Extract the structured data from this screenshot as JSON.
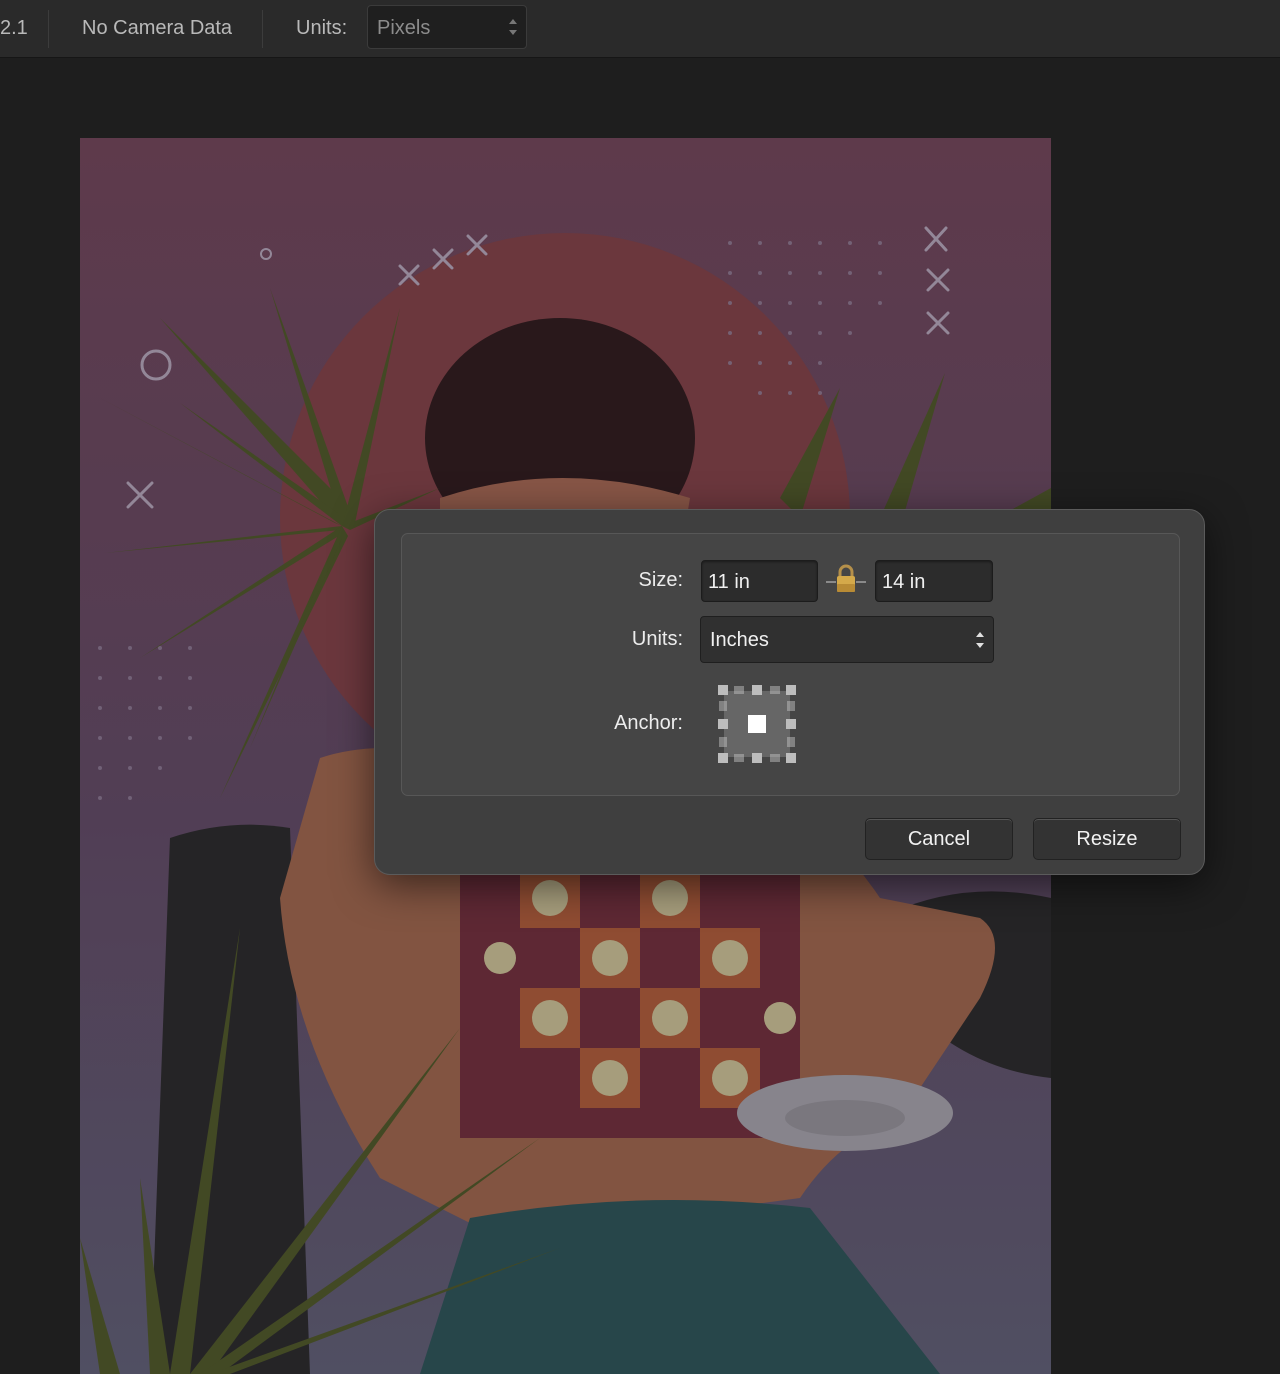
{
  "toolbar": {
    "version_fragment": "2.1",
    "camera_info": "No Camera Data",
    "units_label": "Units:",
    "units_value": "Pixels"
  },
  "dialog": {
    "size_label": "Size:",
    "width_value": "11 in",
    "height_value": "14 in",
    "lock_icon": "lock-icon",
    "units_label": "Units:",
    "units_value": "Inches",
    "anchor_label": "Anchor:",
    "anchor_selected": "center",
    "cancel_label": "Cancel",
    "resize_label": "Resize"
  },
  "colors": {
    "canvas_top": "#6b4356",
    "canvas_bottom": "#5e5a6e",
    "sun": "#7a3f46",
    "dialog_bg": "#3f3f3f",
    "accent_lock": "#d4a94a"
  }
}
